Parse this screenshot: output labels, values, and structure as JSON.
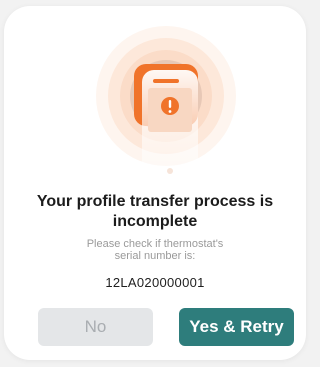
{
  "dialog": {
    "illustration_icon": "phone-alert-icon",
    "title": "Your profile transfer process is\nincomplete",
    "subtitle": "Please check if thermostat's\nserial number is:",
    "serial_number": "12LA020000001",
    "buttons": {
      "no_label": "No",
      "retry_label": "Yes & Retry"
    }
  },
  "colors": {
    "accent_orange": "#f0732a",
    "primary_teal": "#2e7d7c",
    "disabled_button_bg": "#e4e6e8",
    "disabled_button_text": "#a9adb1"
  }
}
